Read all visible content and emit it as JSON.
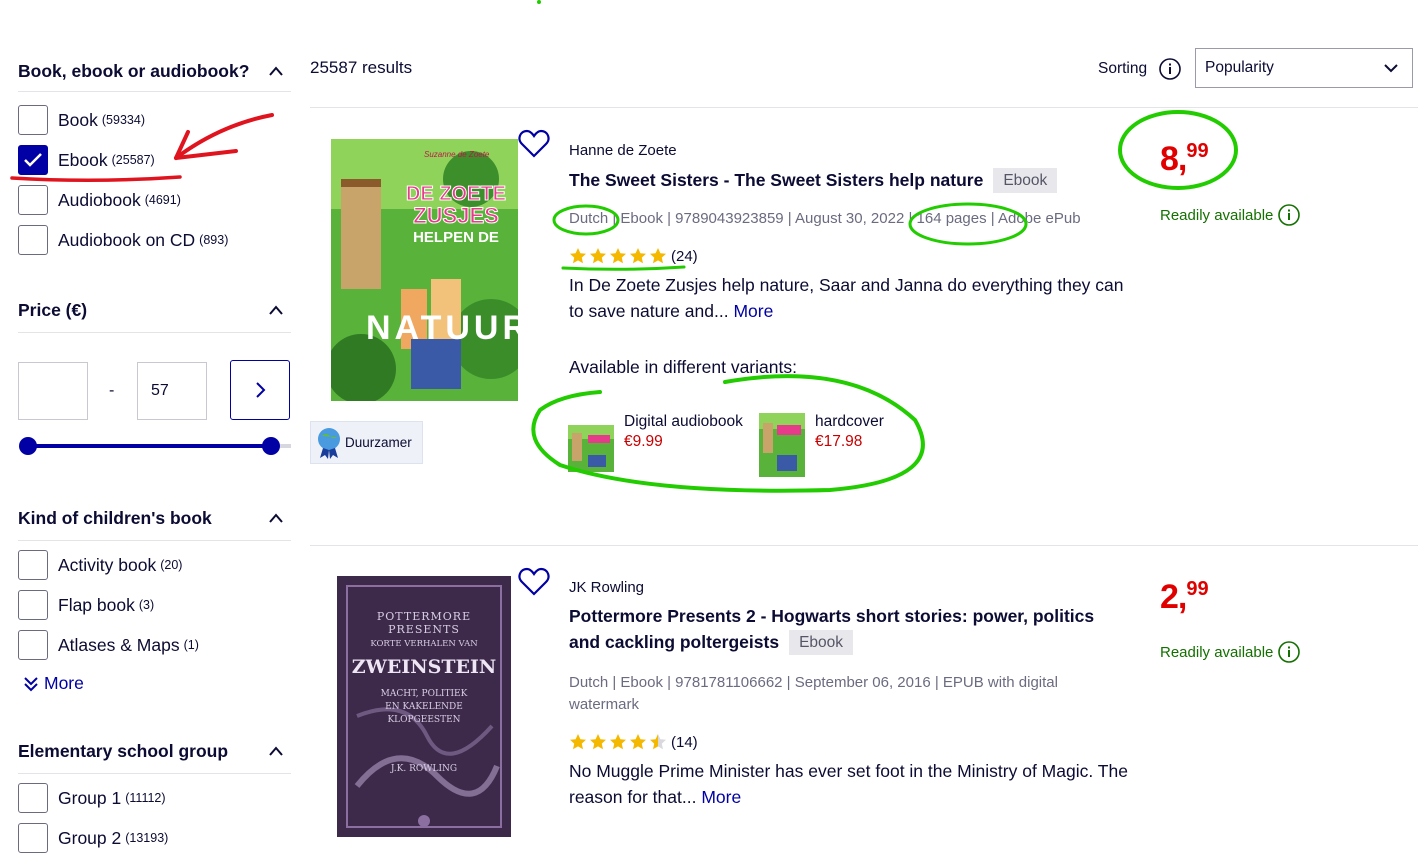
{
  "filters": {
    "format": {
      "title": "Book, ebook or audiobook?",
      "options": [
        {
          "label": "Book",
          "count": "(59334)",
          "checked": false
        },
        {
          "label": "Ebook",
          "count": "(25587)",
          "checked": true
        },
        {
          "label": "Audiobook",
          "count": "(4691)",
          "checked": false
        },
        {
          "label": "Audiobook on CD",
          "count": "(893)",
          "checked": false
        }
      ]
    },
    "price": {
      "title": "Price (€)",
      "min_value": "",
      "separator": "-",
      "max_value": "57"
    },
    "kind": {
      "title": "Kind of children's book",
      "options": [
        {
          "label": "Activity book",
          "count": "(20)"
        },
        {
          "label": "Flap book",
          "count": "(3)"
        },
        {
          "label": "Atlases & Maps",
          "count": "(1)"
        }
      ],
      "more_label": "More"
    },
    "school": {
      "title": "Elementary school group",
      "options": [
        {
          "label": "Group 1",
          "count": "(11112)"
        },
        {
          "label": "Group 2",
          "count": "(13193)"
        }
      ]
    }
  },
  "results": {
    "count_label": "25587 results",
    "sorting_label": "Sorting",
    "sort_value": "Popularity"
  },
  "products": [
    {
      "author": "Hanne de Zoete",
      "title": "The Sweet Sisters - The Sweet Sisters help nature",
      "format_badge": "Ebook",
      "meta": "Dutch | Ebook | 9789043923859 | August 30, 2022 | 164 pages | Adobe ePub",
      "rating": 5,
      "rating_count": "(24)",
      "description": "In De Zoete Zusjes help nature, Saar and Janna do everything they can to save nature and...",
      "more_label": "More",
      "variants_title": "Available in different variants:",
      "variants": [
        {
          "name": "Digital audiobook",
          "price": "€9.99"
        },
        {
          "name": "hardcover",
          "price": "€17.98"
        }
      ],
      "price_main": "8,",
      "price_cents": "99",
      "availability": "Readily available",
      "eco_label": "Duurzamer",
      "cover_lines": [
        "DE ZOETE",
        "ZUSJES",
        "HELPEN DE",
        "NATUUR"
      ]
    },
    {
      "author": "JK Rowling",
      "title": "Pottermore Presents 2 - Hogwarts short stories: power, politics and cackling poltergeists",
      "format_badge": "Ebook",
      "meta": "Dutch | Ebook | 9781781106662 | September 06, 2016 | EPUB with digital watermark",
      "rating": 4.5,
      "rating_count": "(14)",
      "description": "No Muggle Prime Minister has ever set foot in the Ministry of Magic. The reason for that...",
      "more_label": "More",
      "price_main": "2,",
      "price_cents": "99",
      "availability": "Readily available",
      "cover_lines": [
        "POTTERMORE",
        "PRESENTS",
        "KORTE VERHALEN VAN",
        "ZWEINSTEIN",
        "MACHT, POLITIEK",
        "EN KAKELENDE",
        "KLOPGEESTEN",
        "J.K. ROWLING"
      ]
    }
  ],
  "colors": {
    "brand_blue": "#0000a4",
    "price_red": "#e00000",
    "available_green": "#147000",
    "annotation_green": "#22cc00",
    "annotation_red": "#e0141e",
    "star_yellow": "#f5b800"
  },
  "icons": [
    "chevron-up-icon",
    "chevron-down-icon",
    "chevron-right-icon",
    "check-icon",
    "info-icon",
    "heart-icon",
    "star-icon",
    "double-chevron-down-icon",
    "eco-badge-icon"
  ]
}
